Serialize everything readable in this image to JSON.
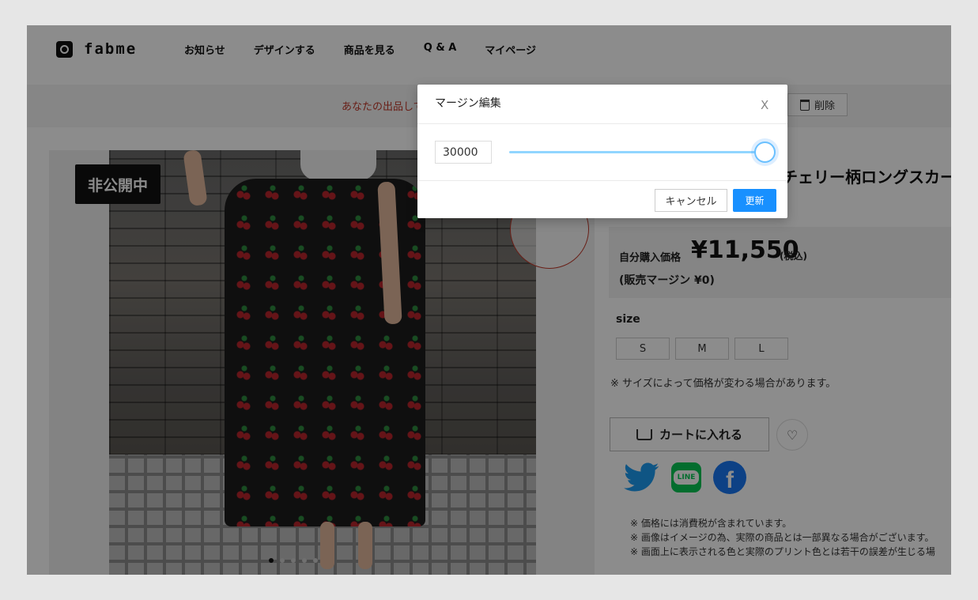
{
  "header": {
    "logo_text": "fabme",
    "nav": [
      "お知らせ",
      "デザインする",
      "商品を見る",
      "Q & A",
      "マイページ"
    ]
  },
  "notice": {
    "text": "あなたの出品して",
    "delete_label": "削除"
  },
  "gallery": {
    "status_badge": "非公開中",
    "dot_count": 5,
    "active_dot": 0
  },
  "product": {
    "title": "チェリー柄ロングスカー",
    "price_label": "自分購入価格",
    "price_value": "¥11,550",
    "price_tax": "(税込)",
    "margin_text": "(販売マージン ¥0)",
    "size_label": "size",
    "sizes": [
      "S",
      "M",
      "L"
    ],
    "size_note": "※ サイズによって価格が変わる場合があります。",
    "cart_label": "カートに入れる",
    "line_label": "LINE",
    "facebook_label": "f",
    "notes": [
      "※ 価格には消費税が含まれています。",
      "※ 画像はイメージの為、実際の商品とは一部異なる場合がございます。",
      "※ 画面上に表示される色と実際のプリント色とは若干の誤差が生じる場"
    ]
  },
  "modal": {
    "title": "マージン編集",
    "close_label": "X",
    "input_value": "30000",
    "slider_fraction": 1.0,
    "cancel_label": "キャンセル",
    "update_label": "更新"
  },
  "colors": {
    "accent": "#1890ff",
    "notice_red": "#c0392b",
    "overlay": "rgba(0,0,0,0.45)"
  }
}
